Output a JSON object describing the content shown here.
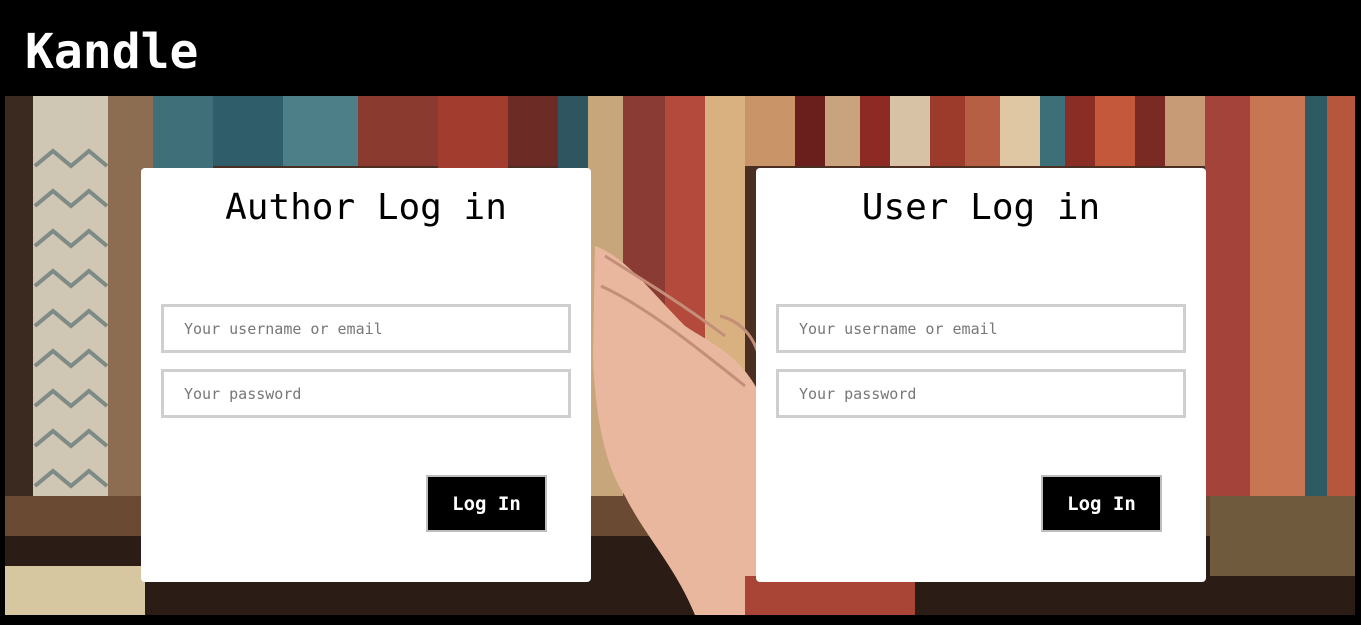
{
  "app": {
    "title": "Kandle"
  },
  "author_login": {
    "title": "Author Log in",
    "username_placeholder": "Your username or email",
    "password_placeholder": "Your password",
    "submit_label": "Log In"
  },
  "user_login": {
    "title": "User Log in",
    "username_placeholder": "Your username or email",
    "password_placeholder": "Your password",
    "submit_label": "Log In"
  },
  "colors": {
    "header_bg": "#000000",
    "card_bg": "#ffffff",
    "button_bg": "#000000",
    "input_border": "#cfcfcf"
  }
}
